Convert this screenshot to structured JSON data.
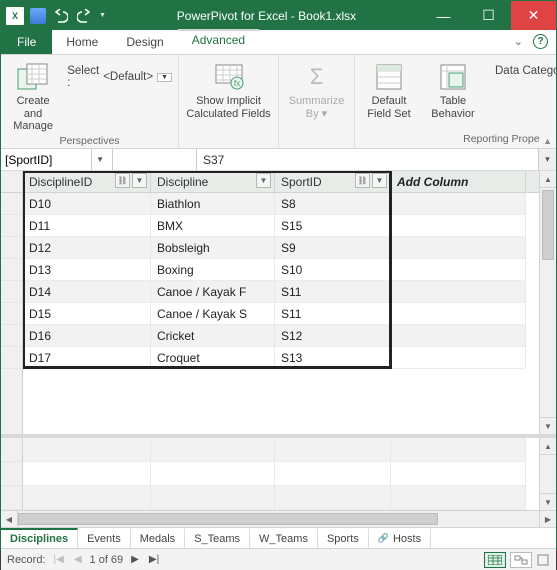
{
  "titlebar": {
    "title": "PowerPivot for Excel - Book1.xlsx"
  },
  "tabs": {
    "file": "File",
    "home": "Home",
    "design": "Design",
    "advanced": "Advanced"
  },
  "ribbon": {
    "create_manage": "Create and\nManage",
    "select_label": "Select :",
    "select_value": "<Default>",
    "show_implicit": "Show Implicit\nCalculated Fields",
    "summarize": "Summarize\nBy ▾",
    "default_fieldset": "Default\nField Set",
    "table_behavior": "Table\nBehavior",
    "data_catego": "Data Catego",
    "group_persp": "Perspectives",
    "group_report": "Reporting Prope"
  },
  "fx": {
    "name": "[SportID]",
    "value": "S37"
  },
  "columns": [
    "DisciplineID",
    "Discipline",
    "SportID"
  ],
  "add_column": "Add Column",
  "rows": [
    {
      "DisciplineID": "D10",
      "Discipline": "Biathlon",
      "SportID": "S8"
    },
    {
      "DisciplineID": "D11",
      "Discipline": "BMX",
      "SportID": "S15"
    },
    {
      "DisciplineID": "D12",
      "Discipline": "Bobsleigh",
      "SportID": "S9"
    },
    {
      "DisciplineID": "D13",
      "Discipline": "Boxing",
      "SportID": "S10"
    },
    {
      "DisciplineID": "D14",
      "Discipline": "Canoe / Kayak F",
      "SportID": "S11"
    },
    {
      "DisciplineID": "D15",
      "Discipline": "Canoe / Kayak S",
      "SportID": "S11"
    },
    {
      "DisciplineID": "D16",
      "Discipline": "Cricket",
      "SportID": "S12"
    },
    {
      "DisciplineID": "D17",
      "Discipline": "Croquet",
      "SportID": "S13"
    }
  ],
  "sheets": [
    "Disciplines",
    "Events",
    "Medals",
    "S_Teams",
    "W_Teams",
    "Sports",
    "Hosts"
  ],
  "status": {
    "label": "Record:",
    "pos": "1 of 69"
  }
}
